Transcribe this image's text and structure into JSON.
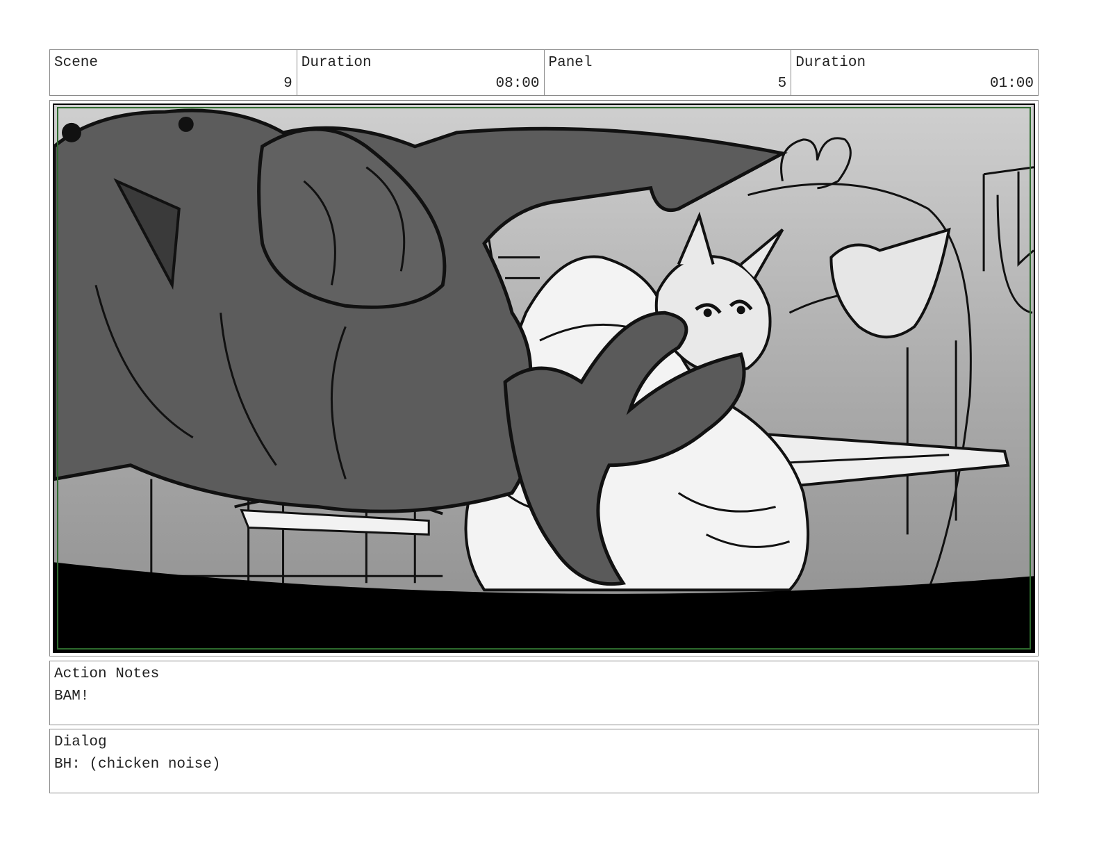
{
  "header": {
    "scene_label": "Scene",
    "scene_value": "9",
    "scene_duration_label": "Duration",
    "scene_duration_value": "08:00",
    "panel_label": "Panel",
    "panel_value": "5",
    "panel_duration_label": "Duration",
    "panel_duration_value": "01:00"
  },
  "action_notes": {
    "label": "Action Notes",
    "text": "BAM!"
  },
  "dialog": {
    "label": "Dialog",
    "text": "BH: (chicken noise)"
  },
  "colors": {
    "border": "#8a8a8a",
    "safe_frame": "#2e6b2e",
    "ink": "#000000",
    "dark_fill": "#5c5c5c",
    "light_fill": "#e6e6e6"
  }
}
